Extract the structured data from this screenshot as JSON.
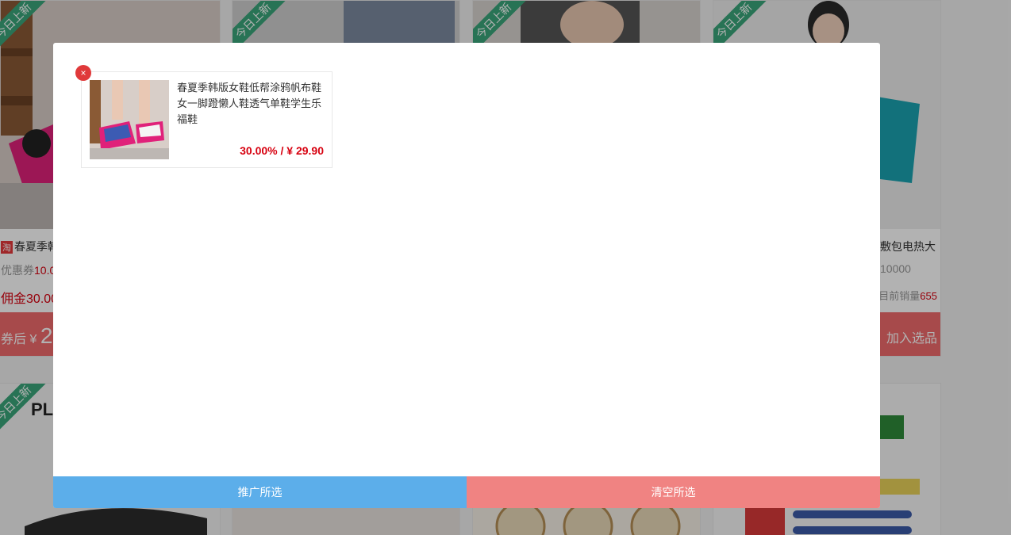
{
  "background": {
    "cards": [
      {
        "ribbon": "今日上新",
        "platform_badge": "淘",
        "title": "春夏季韩",
        "coupon_label": "优惠券",
        "coupon_value": "10.0",
        "commission_label": "佣金",
        "commission_value": "30.00",
        "after_coupon_label": "券后 ¥",
        "after_coupon_value": "2"
      },
      {
        "ribbon": "今日上新"
      },
      {
        "ribbon": "今日上新"
      },
      {
        "ribbon": "今日上新",
        "title": "敷包电热大",
        "coupon_value": "10000",
        "sales_label": "目前销量",
        "sales_value": "655",
        "add_button": "加入选品"
      },
      {
        "ribbon": "今日上新",
        "brand_text": "PL"
      }
    ]
  },
  "modal": {
    "selected_items": [
      {
        "name": "春夏季韩版女鞋低帮涂鸦帆布鞋女一脚蹬懒人鞋透气单鞋学生乐福鞋",
        "price": "30.00% / ¥ 29.90",
        "remove_label": "×"
      }
    ],
    "promote_button": "推广所选",
    "clear_button": "清空所选"
  },
  "colors": {
    "promote": "#5caeea",
    "clear": "#f08382",
    "price": "#d7000f",
    "remove": "#e0393a",
    "ribbon": "#3aa57a"
  }
}
